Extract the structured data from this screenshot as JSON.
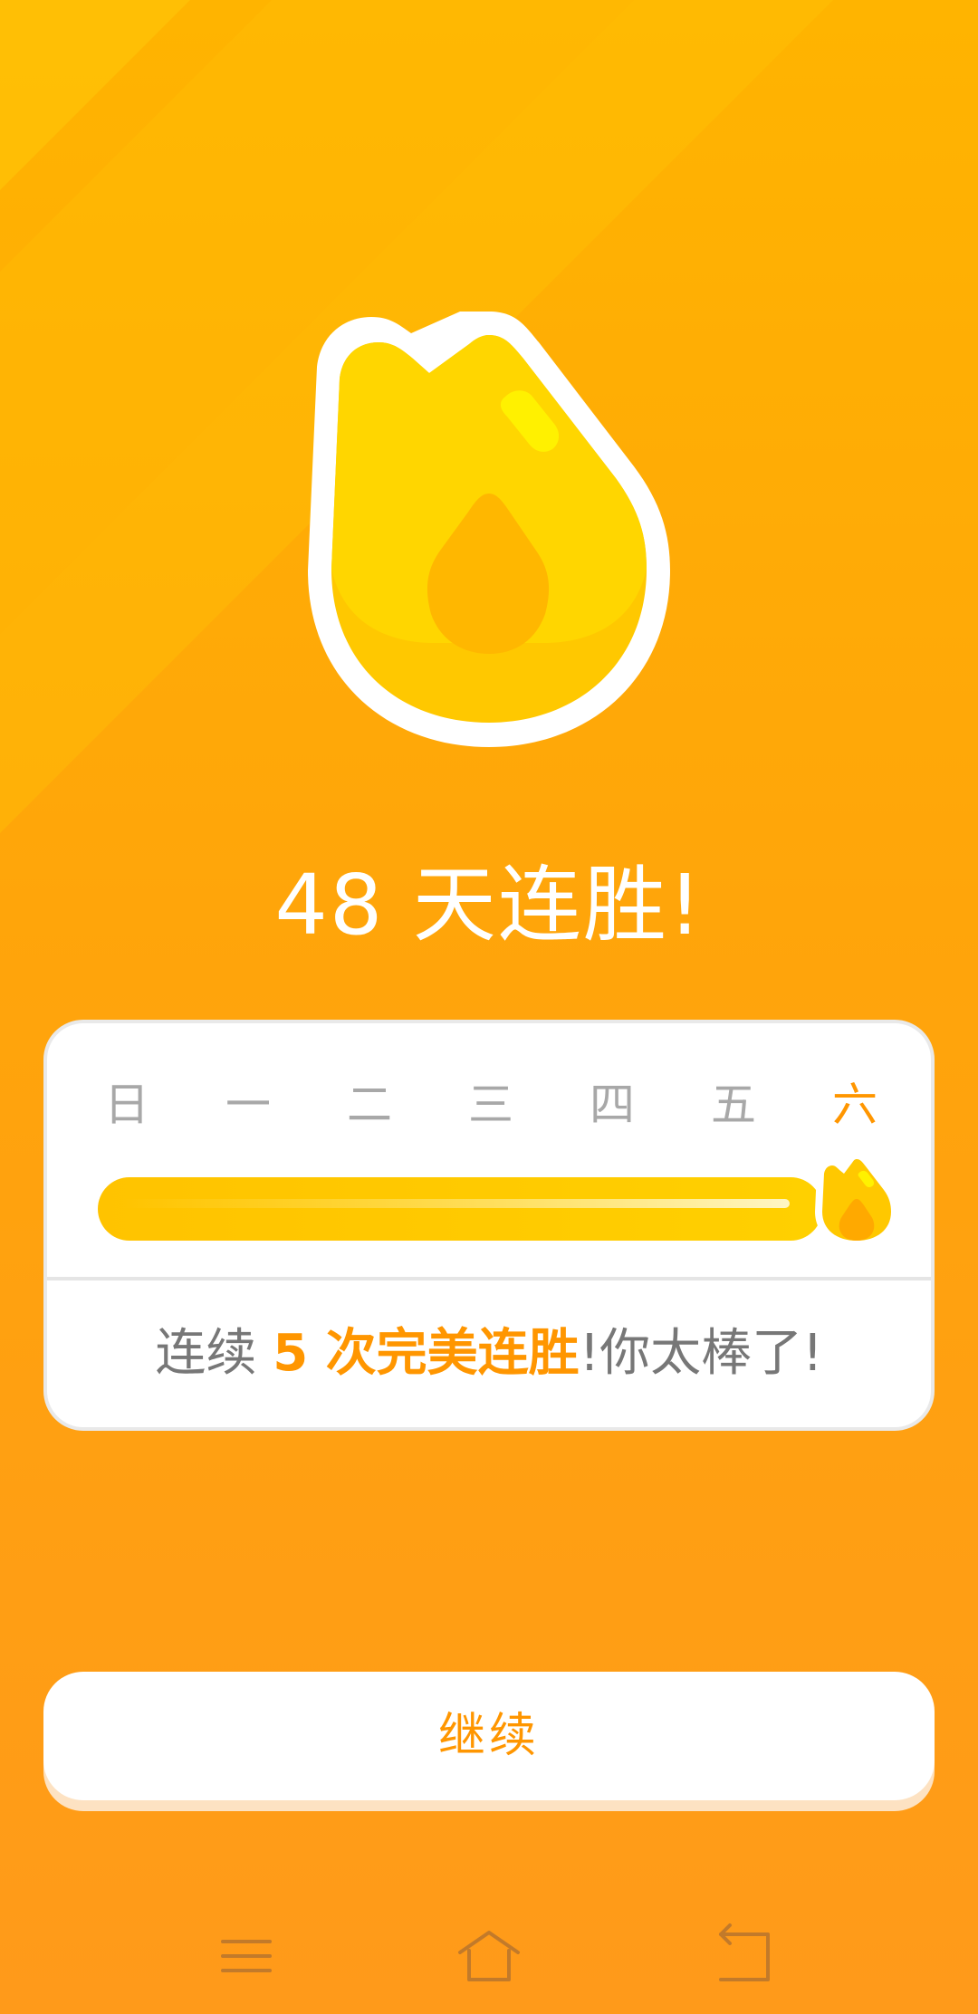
{
  "headline": "48 天连胜!",
  "streak_card": {
    "days": [
      {
        "label": "日",
        "active": false
      },
      {
        "label": "一",
        "active": false
      },
      {
        "label": "二",
        "active": false
      },
      {
        "label": "三",
        "active": false
      },
      {
        "label": "四",
        "active": false
      },
      {
        "label": "五",
        "active": false
      },
      {
        "label": "六",
        "active": true
      }
    ],
    "progress_fraction": 1.0,
    "message": {
      "prefix": "连续 ",
      "highlight": "5 次完美连胜",
      "suffix": "!你太棒了!"
    }
  },
  "continue_button": {
    "label": "继续"
  },
  "nav_bar": {
    "icons": [
      "menu-icon",
      "home-icon",
      "back-icon"
    ]
  },
  "colors": {
    "background_top": "#ffb400",
    "background_bottom": "#ff9a1a",
    "accent": "#ff9600",
    "flame_fill": "#ffc800",
    "flame_highlight": "#fff100",
    "muted_text": "#777777",
    "inactive_day": "#a8a8a8"
  }
}
